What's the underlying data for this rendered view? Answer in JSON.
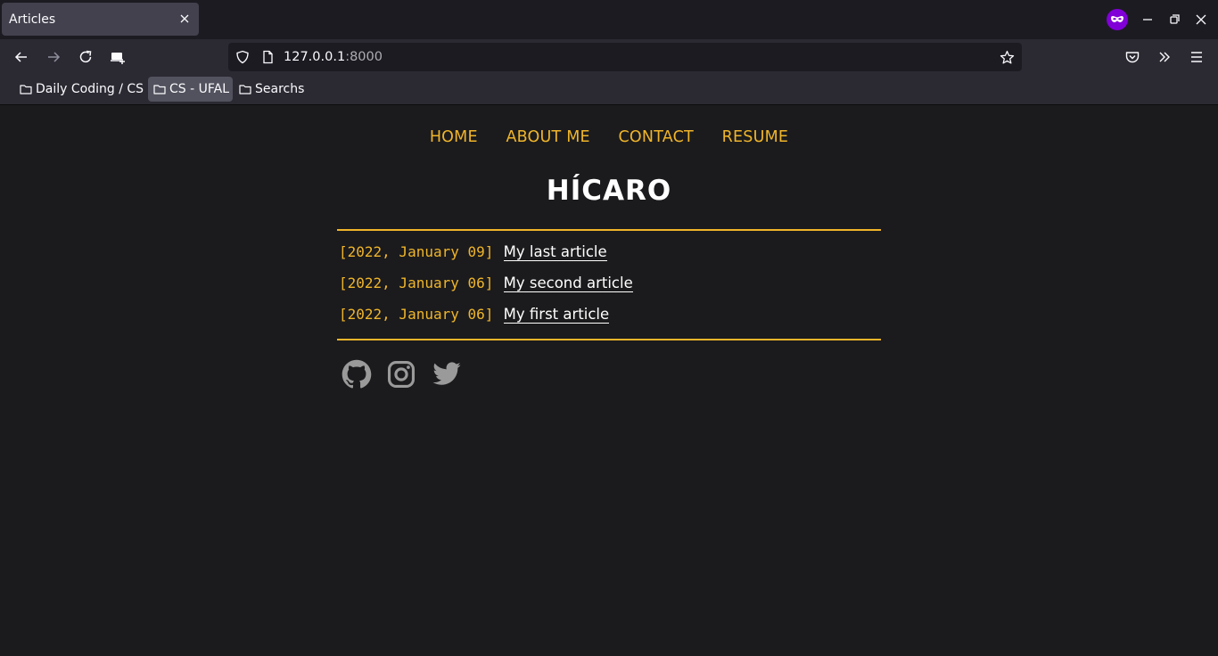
{
  "browser": {
    "tab_title": "Articles",
    "url_host": "127.0.0.1",
    "url_port": ":8000",
    "bookmarks": [
      {
        "label": "Daily Coding / CS",
        "active": false
      },
      {
        "label": "CS - UFAL",
        "active": true
      },
      {
        "label": "Searchs",
        "active": false
      }
    ],
    "private_color": "#8000d7"
  },
  "site": {
    "nav": [
      "HOME",
      "ABOUT ME",
      "CONTACT",
      "RESUME"
    ],
    "title": "HÍCARO",
    "accent_color": "#f0b52a",
    "articles": [
      {
        "date": "[2022, January 09]",
        "title": "My last article"
      },
      {
        "date": "[2022, January 06]",
        "title": "My second article"
      },
      {
        "date": "[2022, January 06]",
        "title": "My first article"
      }
    ],
    "social": [
      "github-icon",
      "instagram-icon",
      "twitter-icon"
    ]
  }
}
